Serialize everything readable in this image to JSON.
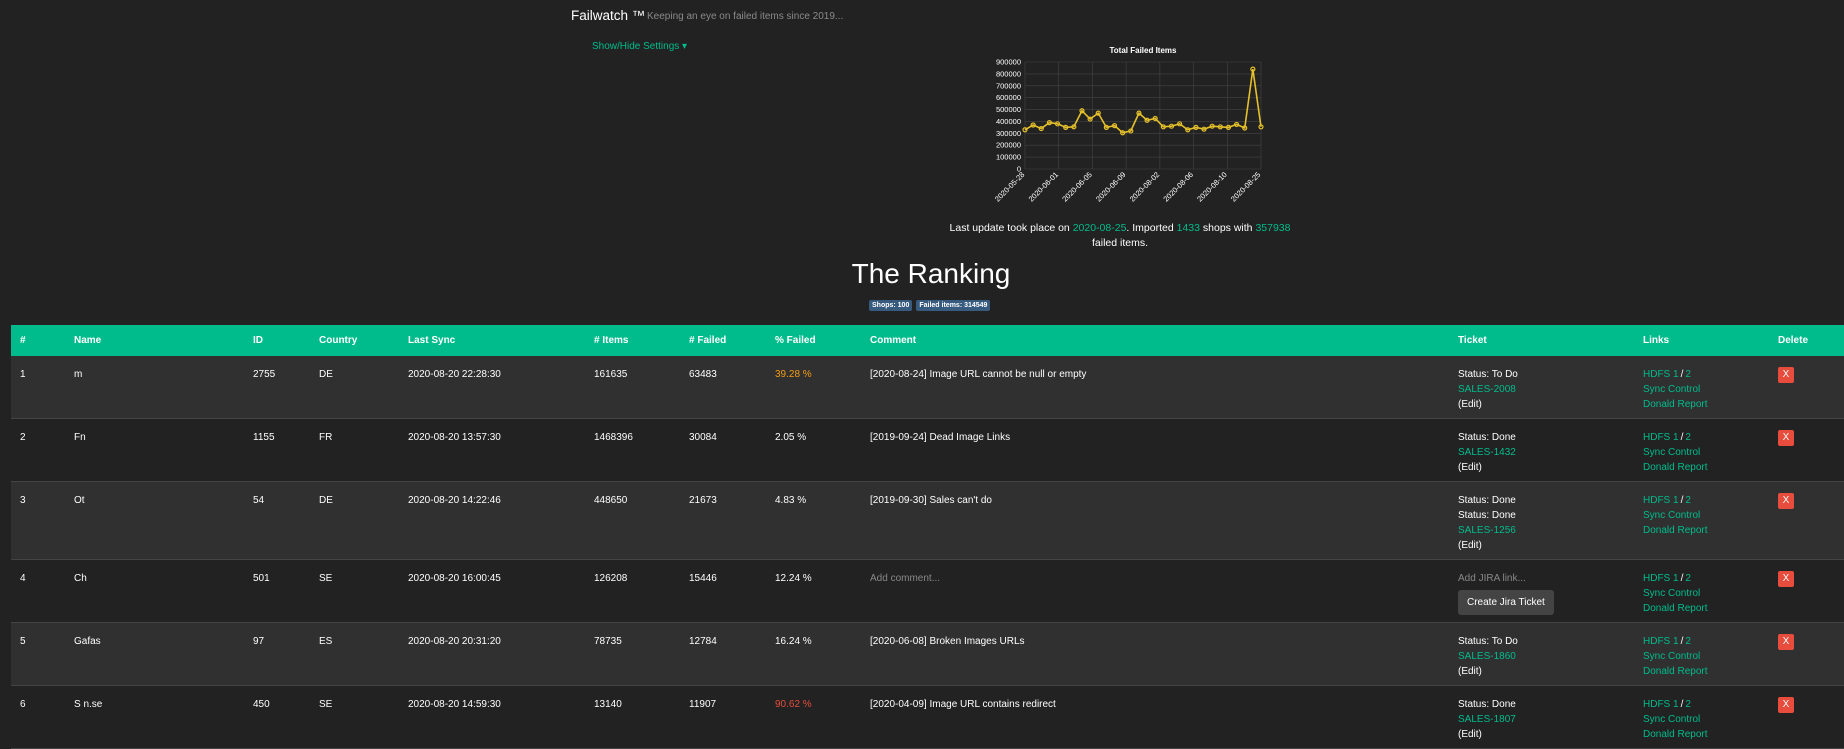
{
  "app": {
    "title": "Failwatch ™",
    "tagline": "Keeping an eye on failed items since 2019...",
    "settings_toggle": "Show/Hide Settings ▾"
  },
  "chart_data": {
    "type": "line",
    "title": "Total Failed Items",
    "y_ticks": [
      "900000",
      "800000",
      "700000",
      "600000",
      "500000",
      "400000",
      "300000",
      "200000",
      "100000",
      "0"
    ],
    "x_tick_labels": [
      "2020-05-28",
      "2020-06-01",
      "2020-06-05",
      "2020-06-09",
      "2020-08-02",
      "2020-08-06",
      "2020-08-10",
      "2020-08-25"
    ],
    "ylim": [
      0,
      900000
    ],
    "values": [
      330000,
      370000,
      340000,
      390000,
      380000,
      350000,
      355000,
      490000,
      420000,
      470000,
      350000,
      365000,
      305000,
      320000,
      470000,
      410000,
      425000,
      355000,
      360000,
      380000,
      330000,
      350000,
      335000,
      360000,
      355000,
      350000,
      375000,
      345000,
      840000,
      355000
    ],
    "color": "#e5c02a"
  },
  "update": {
    "prefix": "Last update took place on",
    "date": "2020-08-25",
    "mid1": ". Imported",
    "shops": "1433",
    "mid2": "shops with",
    "failed": "357938",
    "suffix": "failed items."
  },
  "ranking": {
    "title": "The Ranking",
    "badge_shops": "Shops: 100",
    "badge_failed": "Failed items: 314549"
  },
  "table": {
    "headers": [
      "#",
      "Name",
      "ID",
      "Country",
      "Last Sync",
      "# Items",
      "# Failed",
      "% Failed",
      "Comment",
      "Ticket",
      "Links",
      "Delete"
    ],
    "rows": [
      {
        "n": "1",
        "name": "m",
        "id": "2755",
        "country": "DE",
        "sync": "2020-08-20 22:28:30",
        "items": "161635",
        "failed": "63483",
        "pct": "39.28 %",
        "pct_color": "orange",
        "comment": "[2020-08-24] Image URL cannot be null or empty",
        "status1": "Status: To Do",
        "status2": "",
        "ticket": "SALES-2008",
        "edit": "(Edit)"
      },
      {
        "n": "2",
        "name": "Fn",
        "id": "1155",
        "country": "FR",
        "sync": "2020-08-20 13:57:30",
        "items": "1468396",
        "failed": "30084",
        "pct": "2.05 %",
        "pct_color": "",
        "comment": "[2019-09-24] Dead Image Links",
        "status1": "Status: Done",
        "status2": "",
        "ticket": "SALES-1432",
        "edit": "(Edit)"
      },
      {
        "n": "3",
        "name": "Ot",
        "id": "54",
        "country": "DE",
        "sync": "2020-08-20 14:22:46",
        "items": "448650",
        "failed": "21673",
        "pct": "4.83 %",
        "pct_color": "",
        "comment": "[2019-09-30] Sales can't do",
        "status1": "Status: Done",
        "status2": "Status: Done",
        "ticket": "SALES-1256",
        "edit": "(Edit)"
      },
      {
        "n": "4",
        "name": "Ch",
        "id": "501",
        "country": "SE",
        "sync": "2020-08-20 16:00:45",
        "items": "126208",
        "failed": "15446",
        "pct": "12.24 %",
        "pct_color": "",
        "comment": "",
        "comment_placeholder": "Add comment...",
        "ticket_placeholder": "Add JIRA link...",
        "jira_button": "Create Jira Ticket"
      },
      {
        "n": "5",
        "name": "Gafas",
        "id": "97",
        "country": "ES",
        "sync": "2020-08-20 20:31:20",
        "items": "78735",
        "failed": "12784",
        "pct": "16.24 %",
        "pct_color": "",
        "comment": "[2020-06-08] Broken Images URLs",
        "status1": "Status: To Do",
        "status2": "",
        "ticket": "SALES-1860",
        "edit": "(Edit)"
      },
      {
        "n": "6",
        "name": "S        n.se",
        "id": "450",
        "country": "SE",
        "sync": "2020-08-20 14:59:30",
        "items": "13140",
        "failed": "11907",
        "pct": "90.62 %",
        "pct_color": "red",
        "comment": "[2020-04-09] Image URL contains redirect",
        "status1": "Status: Done",
        "status2": "",
        "ticket": "SALES-1807",
        "edit": "(Edit)"
      }
    ],
    "links": {
      "hdfs": "HDFS 1",
      "sep": "/",
      "two": "2",
      "sync": "Sync Control",
      "report": "Donald Report"
    },
    "delete_label": "X"
  }
}
